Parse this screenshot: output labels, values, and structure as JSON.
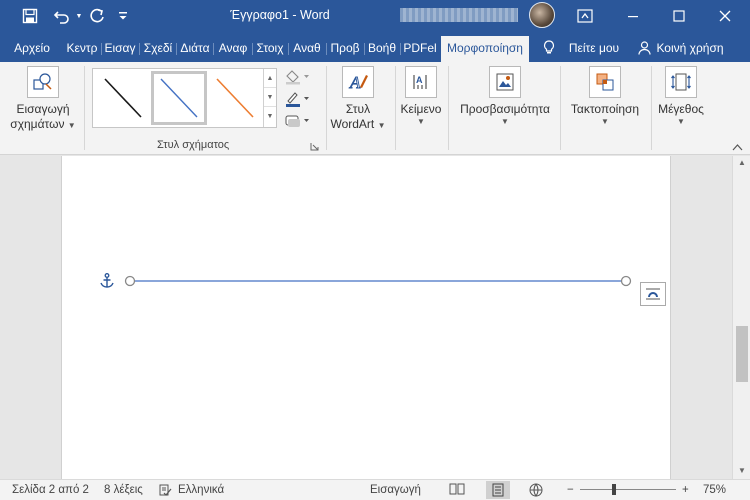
{
  "app": {
    "title": "Έγγραφο1 - Word"
  },
  "quick_access": {
    "icons": [
      "save-icon",
      "undo-icon",
      "redo-icon",
      "customize-icon"
    ]
  },
  "window_controls": [
    "ribbon-display-icon",
    "minimize-icon",
    "maximize-icon",
    "close-icon"
  ],
  "tabs": [
    {
      "label": "Αρχείο"
    },
    {
      "label": "Κεντρ"
    },
    {
      "label": "Εισαγ"
    },
    {
      "label": "Σχεδί"
    },
    {
      "label": "Διάτα"
    },
    {
      "label": "Αναφ"
    },
    {
      "label": "Στοιχ"
    },
    {
      "label": "Αναθ"
    },
    {
      "label": "Προβ"
    },
    {
      "label": "Βοήθ"
    },
    {
      "label": "PDFel"
    },
    {
      "label": "Μορφοποίηση",
      "active": true
    }
  ],
  "tell_me": "Πείτε μου",
  "share": "Κοινή χρήση",
  "ribbon": {
    "insert_shapes": {
      "line1": "Εισαγωγή",
      "line2": "σχημάτων"
    },
    "shape_styles_label": "Στυλ σχήματος",
    "gallery_colors": [
      "#1a1a1a",
      "#4472c4",
      "#ed7d31"
    ],
    "wordart": {
      "line1": "Στυλ",
      "line2": "WordArt"
    },
    "text": "Κείμενο",
    "accessibility": "Προσβασιμότητα",
    "arrange": "Τακτοποίηση",
    "size": "Μέγεθος"
  },
  "document": {
    "line_color": "#4472c4",
    "anchor_icon": "anchor-icon",
    "layout_options_icon": "layout-options-icon"
  },
  "status": {
    "page": "Σελίδα 2 από 2",
    "words": "8 λέξεις",
    "language": "Ελληνικά",
    "mode": "Εισαγωγή",
    "zoom": "75%"
  }
}
